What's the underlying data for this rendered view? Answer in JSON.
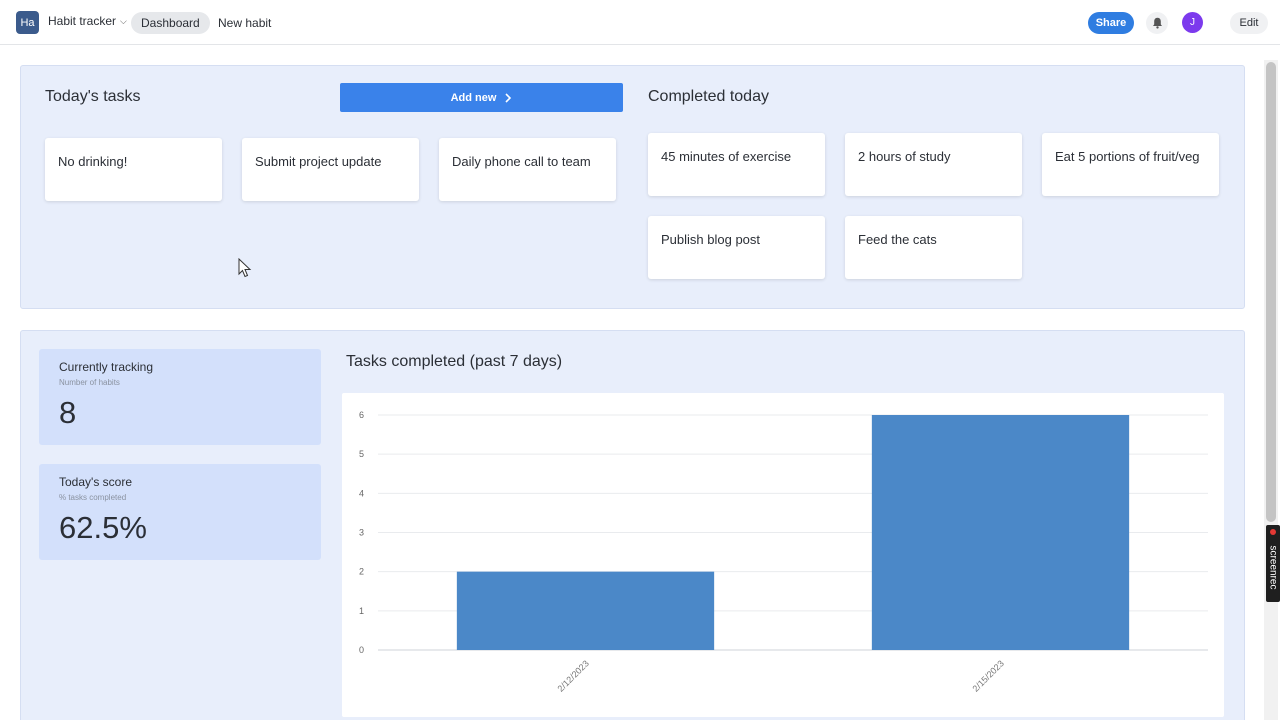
{
  "app": {
    "icon_text": "Ha",
    "name": "Habit tracker"
  },
  "nav": {
    "tabs": [
      {
        "label": "Dashboard",
        "active": true
      },
      {
        "label": "New habit",
        "active": false
      }
    ],
    "share_label": "Share",
    "avatar_initial": "J",
    "edit_label": "Edit"
  },
  "today_tasks": {
    "title": "Today's tasks",
    "add_button_label": "Add new",
    "items": [
      "No drinking!",
      "Submit project update",
      "Daily phone call to team"
    ]
  },
  "completed_today": {
    "title": "Completed today",
    "items": [
      "45 minutes of exercise",
      "2 hours of study",
      "Eat 5 portions of fruit/veg",
      "Publish blog post",
      "Feed the cats"
    ]
  },
  "stats": {
    "tracking": {
      "label": "Currently tracking",
      "sub": "Number of habits",
      "value": "8"
    },
    "score": {
      "label": "Today's score",
      "sub": "% tasks completed",
      "value": "62.5%"
    }
  },
  "chart_title": "Tasks completed (past 7 days)",
  "chart_data": {
    "type": "bar",
    "categories": [
      "2/12/2023",
      "2/15/2023"
    ],
    "values": [
      2,
      6
    ],
    "ylim": [
      0,
      6
    ],
    "yticks": [
      0,
      1,
      2,
      3,
      4,
      5,
      6
    ],
    "grid": true,
    "bar_color": "#4b88c8"
  },
  "recorder": {
    "label": "screenrec"
  },
  "colors": {
    "accent": "#3a82ea",
    "share": "#2f7de1",
    "avatar": "#7c3aed",
    "panel": "#e8eefb",
    "stat": "#d3e0fb"
  }
}
